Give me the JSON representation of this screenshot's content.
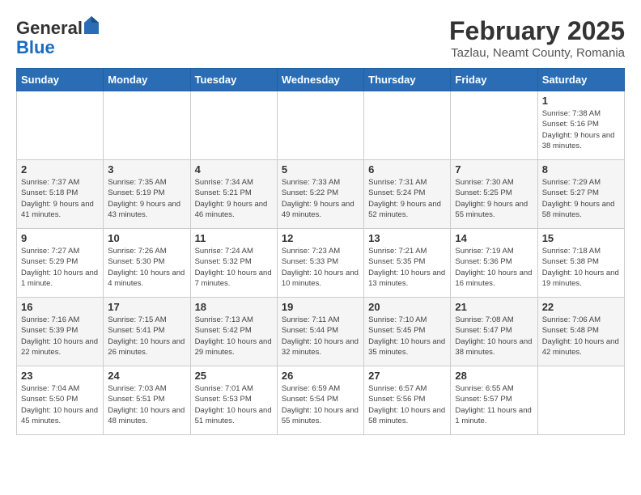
{
  "header": {
    "logo_general": "General",
    "logo_blue": "Blue",
    "month_title": "February 2025",
    "subtitle": "Tazlau, Neamt County, Romania"
  },
  "weekdays": [
    "Sunday",
    "Monday",
    "Tuesday",
    "Wednesday",
    "Thursday",
    "Friday",
    "Saturday"
  ],
  "weeks": [
    [
      {
        "day": "",
        "info": ""
      },
      {
        "day": "",
        "info": ""
      },
      {
        "day": "",
        "info": ""
      },
      {
        "day": "",
        "info": ""
      },
      {
        "day": "",
        "info": ""
      },
      {
        "day": "",
        "info": ""
      },
      {
        "day": "1",
        "info": "Sunrise: 7:38 AM\nSunset: 5:16 PM\nDaylight: 9 hours and 38 minutes."
      }
    ],
    [
      {
        "day": "2",
        "info": "Sunrise: 7:37 AM\nSunset: 5:18 PM\nDaylight: 9 hours and 41 minutes."
      },
      {
        "day": "3",
        "info": "Sunrise: 7:35 AM\nSunset: 5:19 PM\nDaylight: 9 hours and 43 minutes."
      },
      {
        "day": "4",
        "info": "Sunrise: 7:34 AM\nSunset: 5:21 PM\nDaylight: 9 hours and 46 minutes."
      },
      {
        "day": "5",
        "info": "Sunrise: 7:33 AM\nSunset: 5:22 PM\nDaylight: 9 hours and 49 minutes."
      },
      {
        "day": "6",
        "info": "Sunrise: 7:31 AM\nSunset: 5:24 PM\nDaylight: 9 hours and 52 minutes."
      },
      {
        "day": "7",
        "info": "Sunrise: 7:30 AM\nSunset: 5:25 PM\nDaylight: 9 hours and 55 minutes."
      },
      {
        "day": "8",
        "info": "Sunrise: 7:29 AM\nSunset: 5:27 PM\nDaylight: 9 hours and 58 minutes."
      }
    ],
    [
      {
        "day": "9",
        "info": "Sunrise: 7:27 AM\nSunset: 5:29 PM\nDaylight: 10 hours and 1 minute."
      },
      {
        "day": "10",
        "info": "Sunrise: 7:26 AM\nSunset: 5:30 PM\nDaylight: 10 hours and 4 minutes."
      },
      {
        "day": "11",
        "info": "Sunrise: 7:24 AM\nSunset: 5:32 PM\nDaylight: 10 hours and 7 minutes."
      },
      {
        "day": "12",
        "info": "Sunrise: 7:23 AM\nSunset: 5:33 PM\nDaylight: 10 hours and 10 minutes."
      },
      {
        "day": "13",
        "info": "Sunrise: 7:21 AM\nSunset: 5:35 PM\nDaylight: 10 hours and 13 minutes."
      },
      {
        "day": "14",
        "info": "Sunrise: 7:19 AM\nSunset: 5:36 PM\nDaylight: 10 hours and 16 minutes."
      },
      {
        "day": "15",
        "info": "Sunrise: 7:18 AM\nSunset: 5:38 PM\nDaylight: 10 hours and 19 minutes."
      }
    ],
    [
      {
        "day": "16",
        "info": "Sunrise: 7:16 AM\nSunset: 5:39 PM\nDaylight: 10 hours and 22 minutes."
      },
      {
        "day": "17",
        "info": "Sunrise: 7:15 AM\nSunset: 5:41 PM\nDaylight: 10 hours and 26 minutes."
      },
      {
        "day": "18",
        "info": "Sunrise: 7:13 AM\nSunset: 5:42 PM\nDaylight: 10 hours and 29 minutes."
      },
      {
        "day": "19",
        "info": "Sunrise: 7:11 AM\nSunset: 5:44 PM\nDaylight: 10 hours and 32 minutes."
      },
      {
        "day": "20",
        "info": "Sunrise: 7:10 AM\nSunset: 5:45 PM\nDaylight: 10 hours and 35 minutes."
      },
      {
        "day": "21",
        "info": "Sunrise: 7:08 AM\nSunset: 5:47 PM\nDaylight: 10 hours and 38 minutes."
      },
      {
        "day": "22",
        "info": "Sunrise: 7:06 AM\nSunset: 5:48 PM\nDaylight: 10 hours and 42 minutes."
      }
    ],
    [
      {
        "day": "23",
        "info": "Sunrise: 7:04 AM\nSunset: 5:50 PM\nDaylight: 10 hours and 45 minutes."
      },
      {
        "day": "24",
        "info": "Sunrise: 7:03 AM\nSunset: 5:51 PM\nDaylight: 10 hours and 48 minutes."
      },
      {
        "day": "25",
        "info": "Sunrise: 7:01 AM\nSunset: 5:53 PM\nDaylight: 10 hours and 51 minutes."
      },
      {
        "day": "26",
        "info": "Sunrise: 6:59 AM\nSunset: 5:54 PM\nDaylight: 10 hours and 55 minutes."
      },
      {
        "day": "27",
        "info": "Sunrise: 6:57 AM\nSunset: 5:56 PM\nDaylight: 10 hours and 58 minutes."
      },
      {
        "day": "28",
        "info": "Sunrise: 6:55 AM\nSunset: 5:57 PM\nDaylight: 11 hours and 1 minute."
      },
      {
        "day": "",
        "info": ""
      }
    ]
  ]
}
